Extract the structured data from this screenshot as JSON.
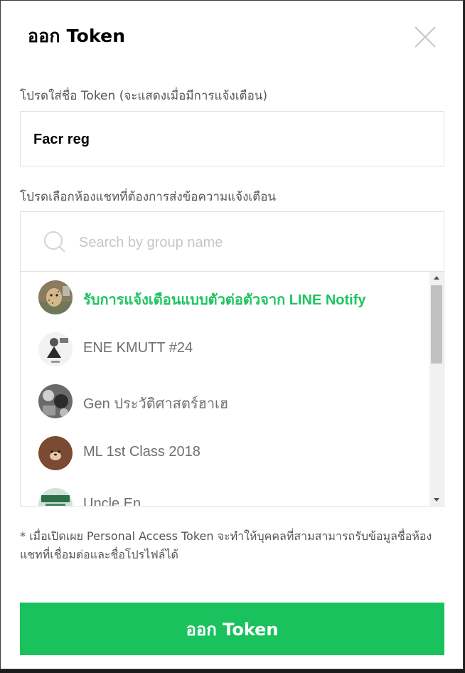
{
  "dialog": {
    "title": "ออก Token",
    "close_icon": "close-icon"
  },
  "token_name": {
    "label": "โปรดใส่ชื่อ Token (จะแสดงเมื่อมีการแจ้งเตือน)",
    "value": "Facr reg"
  },
  "chat_select": {
    "label": "โปรดเลือกห้องแชทที่ต้องการส่งข้อความแจ้งเตือน",
    "search_placeholder": "Search by group name",
    "items": [
      {
        "label": "รับการแจ้งเตือนแบบตัวต่อตัวจาก LINE Notify",
        "active": true,
        "avatar": "cheetah-avatar"
      },
      {
        "label": "ENE KMUTT #24",
        "active": false,
        "avatar": "group-avatar"
      },
      {
        "label": "Gen ประวัติศาสตร์ฮาเฮ",
        "active": false,
        "avatar": "group-avatar"
      },
      {
        "label": "ML 1st Class 2018",
        "active": false,
        "avatar": "bear-avatar"
      },
      {
        "label": "Uncle En",
        "active": false,
        "avatar": "python-avatar"
      }
    ]
  },
  "note": "* เมื่อเปิดเผย Personal Access Token จะทำให้บุคคลที่สามสามารถรับข้อมูลชื่อห้องแชทที่เชื่อมต่อและชื่อโปรไฟล์ได้",
  "submit_label": "ออก Token",
  "colors": {
    "accent": "#19c25d",
    "active_text": "#1ec45f"
  }
}
